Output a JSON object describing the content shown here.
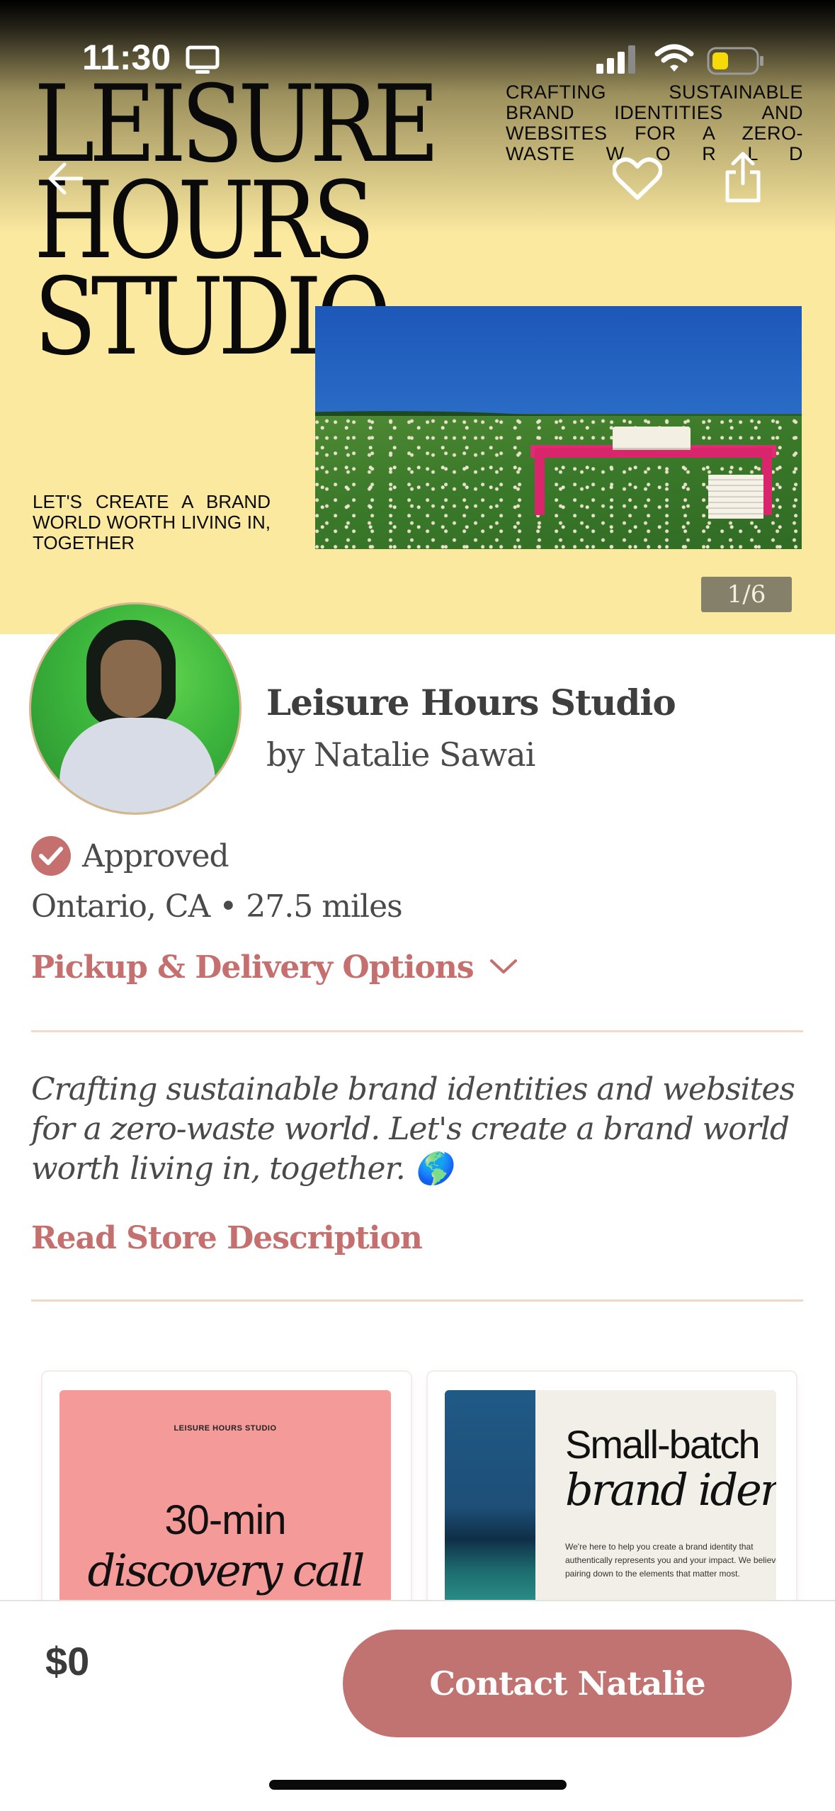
{
  "status_bar": {
    "time": "11:30"
  },
  "hero": {
    "brand_title": "LEISURE\nHOURS\nSTUDIO",
    "tagline": "CRAFTING SUSTAINABLE BRAND IDENTITIES AND WEBSITES FOR A ZERO-WASTE W O R L D",
    "subline": "LET'S CREATE A BRAND WORLD WORTH LIVING IN, TOGETHER",
    "image_counter": "1/6"
  },
  "store": {
    "name": "Leisure Hours Studio",
    "owner": "by Natalie Sawai",
    "approved_label": "Approved",
    "location": "Ontario, CA • 27.5 miles",
    "pickup_label": "Pickup & Delivery Options",
    "description": "Crafting sustainable brand identities and websites for a zero-waste world. Let's create a brand world worth living in, together. 🌎",
    "read_more": "Read Store Description"
  },
  "products": [
    {
      "brand": "LEISURE HOURS STUDIO",
      "line1": "30-min",
      "line2": "discovery call"
    },
    {
      "line1": "Small-batch",
      "line2": "brand identity",
      "body": "We're here to help you create a brand identity that authentically represents you and your impact. We believe in pairing down to the elements that matter most."
    }
  ],
  "bottom_bar": {
    "price": "$0",
    "contact_label": "Contact Natalie"
  },
  "colors": {
    "accent": "#c5706f",
    "hero_bg": "#fbe9a0",
    "button": "#c07371"
  },
  "icons": [
    "back-arrow-icon",
    "heart-icon",
    "share-icon",
    "checkmark-badge-icon",
    "chevron-down-icon",
    "monitor-icon",
    "signal-icon",
    "wifi-icon",
    "battery-icon"
  ]
}
